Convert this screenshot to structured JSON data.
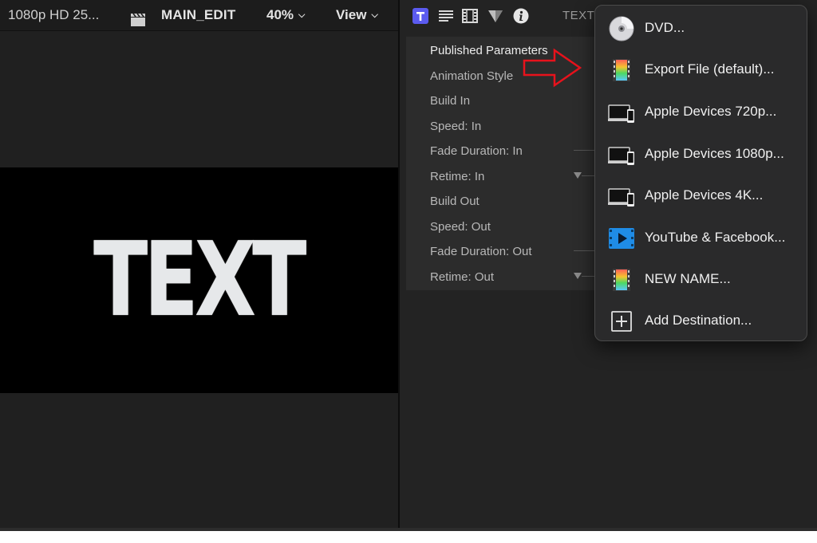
{
  "viewer": {
    "format": "1080p HD 25...",
    "project": "MAIN_EDIT",
    "zoom": "40%",
    "view_label": "View",
    "canvas_text": "TEXT"
  },
  "inspector": {
    "title": "TEXT",
    "tabs": [
      "text-icon",
      "paragraph-icon",
      "film-icon",
      "shape-icon",
      "info-icon"
    ],
    "params": [
      "Published Parameters",
      "Animation Style",
      "Build In",
      "Speed: In",
      "Fade Duration: In",
      "Retime: In",
      "Build Out",
      "Speed: Out",
      "Fade Duration: Out",
      "Retime: Out"
    ]
  },
  "share_menu": {
    "items": [
      {
        "label": "DVD...",
        "icon": "dvd-icon"
      },
      {
        "label": "Export File (default)...",
        "icon": "film-strip-icon"
      },
      {
        "label": "Apple Devices 720p...",
        "icon": "devices-icon"
      },
      {
        "label": "Apple Devices 1080p...",
        "icon": "devices-icon"
      },
      {
        "label": "Apple Devices 4K...",
        "icon": "devices-icon"
      },
      {
        "label": "YouTube & Facebook...",
        "icon": "youtube-icon"
      },
      {
        "label": "NEW NAME...",
        "icon": "film-strip-icon"
      },
      {
        "label": "Add Destination...",
        "icon": "plus-box-icon"
      }
    ]
  },
  "colors": {
    "accent": "#5b5bf0",
    "annotation": "#e8121c",
    "menu_bg": "#2a2a2b"
  }
}
